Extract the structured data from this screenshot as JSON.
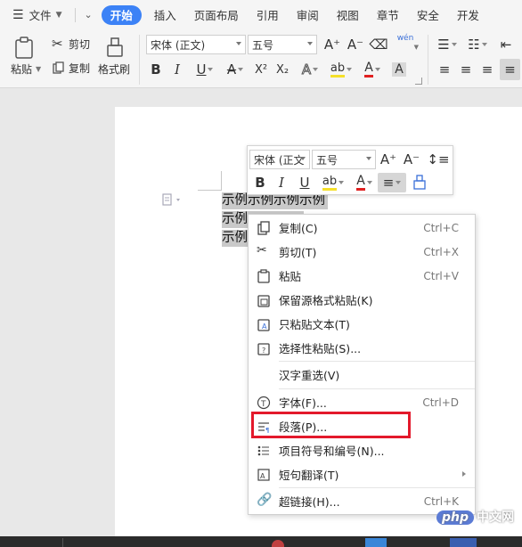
{
  "menubar": {
    "file": "文件",
    "tabs": [
      {
        "label": "开始"
      },
      {
        "label": "插入"
      },
      {
        "label": "页面布局"
      },
      {
        "label": "引用"
      },
      {
        "label": "审阅"
      },
      {
        "label": "视图"
      },
      {
        "label": "章节"
      },
      {
        "label": "安全"
      },
      {
        "label": "开发"
      }
    ]
  },
  "ribbon": {
    "paste": "粘贴",
    "cut": "剪切",
    "copy": "复制",
    "format_painter": "格式刷",
    "font_name": "宋体 (正文)",
    "font_size": "五号",
    "bold": "B",
    "italic": "I",
    "underline": "U",
    "strike": "A",
    "superscript": "X²",
    "subscript": "X₂",
    "grow_font": "A⁺",
    "shrink_font": "A⁻",
    "font_color": "A",
    "char_shading": "A",
    "phonetic": "wén"
  },
  "document": {
    "lines": [
      "示例示例示例示例",
      "示例",
      "示例"
    ]
  },
  "minibar": {
    "font_name": "宋体 (正文",
    "font_size": "五号",
    "bold": "B",
    "italic": "I",
    "underline": "U",
    "font_color": "A"
  },
  "context_menu": {
    "items": [
      {
        "label": "复制(C)",
        "shortcut": "Ctrl+C"
      },
      {
        "label": "剪切(T)",
        "shortcut": "Ctrl+X"
      },
      {
        "label": "粘贴",
        "shortcut": "Ctrl+V"
      },
      {
        "label": "保留源格式粘贴(K)",
        "shortcut": ""
      },
      {
        "label": "只粘贴文本(T)",
        "shortcut": ""
      },
      {
        "label": "选择性粘贴(S)...",
        "shortcut": ""
      },
      {
        "label": "汉字重选(V)",
        "shortcut": ""
      },
      {
        "label": "字体(F)...",
        "shortcut": "Ctrl+D"
      },
      {
        "label": "段落(P)...",
        "shortcut": ""
      },
      {
        "label": "项目符号和编号(N)...",
        "shortcut": ""
      },
      {
        "label": "短句翻译(T)",
        "shortcut": ""
      },
      {
        "label": "超链接(H)...",
        "shortcut": "Ctrl+K"
      }
    ]
  },
  "watermark": {
    "logo": "php",
    "text": "中文网"
  },
  "colors": {
    "accent": "#3c82f6",
    "highlight_border": "#e3192b",
    "font_color_bar": "#e02020",
    "highlighter": "#f5e02a"
  }
}
